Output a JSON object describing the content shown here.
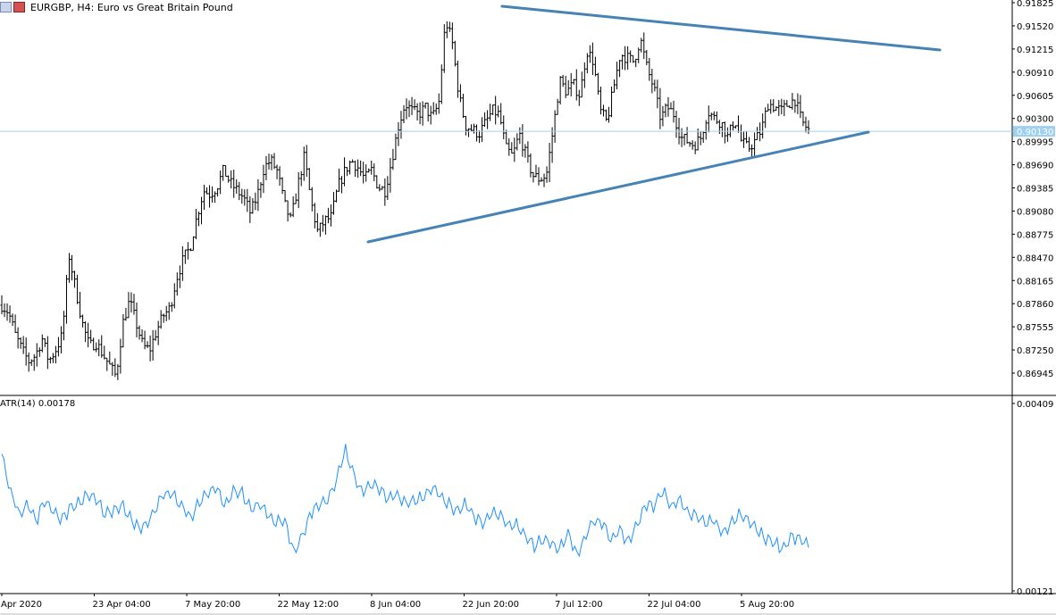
{
  "window": {
    "title": "EURGBP, H4:  Euro vs Great Britain Pound",
    "icon": "chart-window-icon"
  },
  "price_panel": {
    "current_price_label": "0.90130",
    "current_price": 0.9013,
    "y_ticks": [
      "0.91825",
      "0.91520",
      "0.91215",
      "0.90910",
      "0.90605",
      "0.90300",
      "0.89995",
      "0.89690",
      "0.89385",
      "0.89080",
      "0.88775",
      "0.88470",
      "0.88165",
      "0.87860",
      "0.87555",
      "0.87250",
      "0.86945"
    ]
  },
  "indicator_panel": {
    "label": "ATR(14) 0.00178",
    "y_ticks": [
      "0.00409",
      "0.00121"
    ]
  },
  "time_axis": {
    "labels": [
      "Apr 2020",
      "23 Apr 04:00",
      "7 May 20:00",
      "22 May 12:00",
      "8 Jun 04:00",
      "22 Jun 20:00",
      "7 Jul 12:00",
      "22 Jul 04:00",
      "5 Aug 20:00"
    ]
  },
  "colors": {
    "candle": "#000000",
    "atr": "#1e90ff",
    "trendline": "#4682b4",
    "price_line": "#9fd0f0",
    "price_label_bg": "#9fd0f0"
  },
  "chart_data": [
    {
      "type": "line",
      "title": "EURGBP, H4:  Euro vs Great Britain Pound",
      "series_kind": "bar-ohlc",
      "ylim": [
        0.8675,
        0.9185
      ],
      "x_labels": [
        "Apr 2020",
        "23 Apr 04:00",
        "7 May 20:00",
        "22 May 12:00",
        "8 Jun 04:00",
        "22 Jun 20:00",
        "7 Jul 12:00",
        "22 Jul 04:00",
        "5 Aug 20:00"
      ],
      "path": [
        [
          0,
          0.8784
        ],
        [
          1,
          0.8775
        ],
        [
          2,
          0.8745
        ],
        [
          3,
          0.8725
        ],
        [
          4,
          0.871
        ],
        [
          5,
          0.8718
        ],
        [
          6,
          0.874
        ],
        [
          7,
          0.871
        ],
        [
          8,
          0.8725
        ],
        [
          9,
          0.8745
        ],
        [
          10,
          0.885
        ],
        [
          11,
          0.8805
        ],
        [
          12,
          0.876
        ],
        [
          13,
          0.873
        ],
        [
          14,
          0.8735
        ],
        [
          15,
          0.872
        ],
        [
          16,
          0.8705
        ],
        [
          17,
          0.869
        ],
        [
          18,
          0.876
        ],
        [
          19,
          0.879
        ],
        [
          20,
          0.876
        ],
        [
          21,
          0.873
        ],
        [
          22,
          0.8725
        ],
        [
          23,
          0.875
        ],
        [
          24,
          0.877
        ],
        [
          25,
          0.878
        ],
        [
          26,
          0.882
        ],
        [
          27,
          0.8845
        ],
        [
          28,
          0.886
        ],
        [
          29,
          0.89
        ],
        [
          30,
          0.8935
        ],
        [
          31,
          0.893
        ],
        [
          32,
          0.894
        ],
        [
          33,
          0.8962
        ],
        [
          34,
          0.8945
        ],
        [
          35,
          0.8935
        ],
        [
          36,
          0.8925
        ],
        [
          37,
          0.8905
        ],
        [
          38,
          0.8928
        ],
        [
          39,
          0.8965
        ],
        [
          40,
          0.8975
        ],
        [
          41,
          0.896
        ],
        [
          42,
          0.8918
        ],
        [
          43,
          0.8895
        ],
        [
          44,
          0.894
        ],
        [
          45,
          0.898
        ],
        [
          46,
          0.892
        ],
        [
          47,
          0.888
        ],
        [
          48,
          0.8895
        ],
        [
          49,
          0.89
        ],
        [
          50,
          0.894
        ],
        [
          51,
          0.896
        ],
        [
          52,
          0.8975
        ],
        [
          53,
          0.8965
        ],
        [
          54,
          0.895
        ],
        [
          55,
          0.8962
        ],
        [
          56,
          0.894
        ],
        [
          57,
          0.8935
        ],
        [
          58,
          0.8975
        ],
        [
          59,
          0.902
        ],
        [
          60,
          0.905
        ],
        [
          61,
          0.904
        ],
        [
          62,
          0.9035
        ],
        [
          63,
          0.9045
        ],
        [
          64,
          0.903
        ],
        [
          65,
          0.905
        ],
        [
          66,
          0.916
        ],
        [
          67,
          0.913
        ],
        [
          68,
          0.906
        ],
        [
          69,
          0.902
        ],
        [
          70,
          0.9015
        ],
        [
          71,
          0.901
        ],
        [
          72,
          0.9025
        ],
        [
          73,
          0.904
        ],
        [
          74,
          0.9035
        ],
        [
          75,
          0.899
        ],
        [
          76,
          0.898
        ],
        [
          77,
          0.901
        ],
        [
          78,
          0.898
        ],
        [
          79,
          0.8955
        ],
        [
          80,
          0.895
        ],
        [
          81,
          0.8955
        ],
        [
          82,
          0.9015
        ],
        [
          83,
          0.908
        ],
        [
          84,
          0.9065
        ],
        [
          85,
          0.9075
        ],
        [
          86,
          0.906
        ],
        [
          87,
          0.912
        ],
        [
          88,
          0.9105
        ],
        [
          89,
          0.904
        ],
        [
          90,
          0.9025
        ],
        [
          91,
          0.907
        ],
        [
          92,
          0.9115
        ],
        [
          93,
          0.911
        ],
        [
          94,
          0.9105
        ],
        [
          95,
          0.9135
        ],
        [
          96,
          0.9095
        ],
        [
          97,
          0.907
        ],
        [
          98,
          0.903
        ],
        [
          99,
          0.9045
        ],
        [
          100,
          0.9035
        ],
        [
          101,
          0.9005
        ],
        [
          102,
          0.9
        ],
        [
          103,
          0.8995
        ],
        [
          104,
          0.9005
        ],
        [
          105,
          0.904
        ],
        [
          106,
          0.903
        ],
        [
          107,
          0.9025
        ],
        [
          108,
          0.9005
        ],
        [
          109,
          0.903
        ],
        [
          110,
          0.9
        ],
        [
          111,
          0.899
        ],
        [
          112,
          0.9
        ],
        [
          113,
          0.9015
        ],
        [
          114,
          0.905
        ],
        [
          115,
          0.9045
        ],
        [
          116,
          0.904
        ],
        [
          117,
          0.905
        ],
        [
          118,
          0.9055
        ],
        [
          119,
          0.9025
        ],
        [
          120,
          0.9015
        ]
      ]
    },
    {
      "type": "line",
      "title": "ATR(14) 0.00178",
      "ylim": [
        0.00121,
        0.00409
      ],
      "values": [
        0.0033,
        0.00275,
        0.0024,
        0.00255,
        0.00228,
        0.0026,
        0.00245,
        0.0023,
        0.0025,
        0.00255,
        0.0027,
        0.0026,
        0.0024,
        0.00245,
        0.00252,
        0.00235,
        0.00215,
        0.00225,
        0.0025,
        0.00272,
        0.00268,
        0.0025,
        0.00235,
        0.00255,
        0.0027,
        0.0028,
        0.0025,
        0.00275,
        0.00272,
        0.00245,
        0.00255,
        0.0024,
        0.00225,
        0.0023,
        0.0018,
        0.00205,
        0.0024,
        0.00255,
        0.0026,
        0.0029,
        0.0034,
        0.003,
        0.0027,
        0.00285,
        0.00278,
        0.0026,
        0.0027,
        0.00255,
        0.0026,
        0.00265,
        0.0028,
        0.0027,
        0.00255,
        0.0024,
        0.00255,
        0.00235,
        0.00225,
        0.0024,
        0.00238,
        0.0022,
        0.00225,
        0.00205,
        0.0019,
        0.002,
        0.00195,
        0.00185,
        0.0021,
        0.00175,
        0.00205,
        0.0023,
        0.00225,
        0.002,
        0.00215,
        0.00195,
        0.0022,
        0.00255,
        0.0025,
        0.00275,
        0.0025,
        0.0026,
        0.0024,
        0.00235,
        0.00225,
        0.0023,
        0.0021,
        0.00225,
        0.0024,
        0.0023,
        0.00215,
        0.002,
        0.00195,
        0.00185,
        0.00205,
        0.002,
        0.0019
      ]
    }
  ]
}
